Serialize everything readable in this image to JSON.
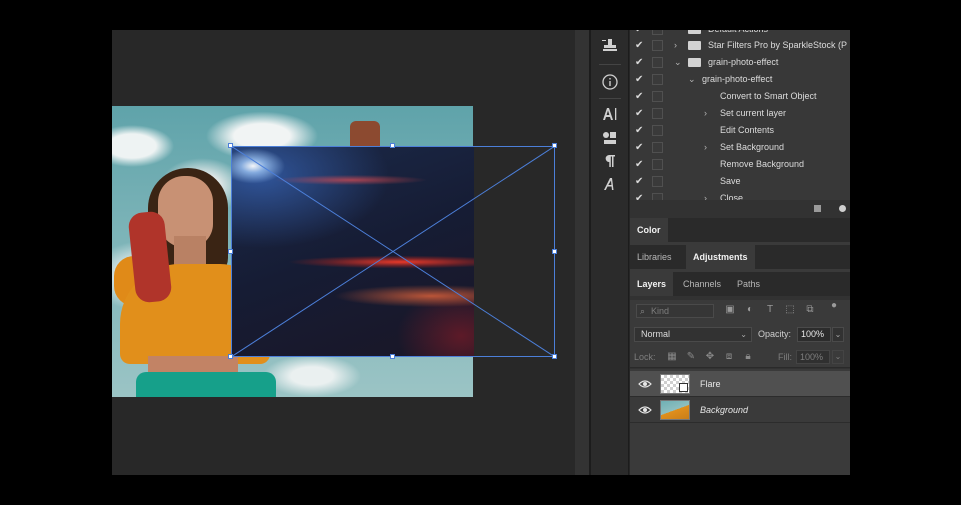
{
  "actions": {
    "items": [
      {
        "label": "Default Actions",
        "level": 0,
        "chevron": "",
        "folder": true
      },
      {
        "label": "Star Filters Pro by SparkleStock (P",
        "level": 0,
        "chevron": "›",
        "folder": true
      },
      {
        "label": "grain-photo-effect",
        "level": 0,
        "chevron": "⌄",
        "folder": true
      },
      {
        "label": "grain-photo-effect",
        "level": 1,
        "chevron": "⌄",
        "folder": false
      },
      {
        "label": "Convert to Smart Object",
        "level": 2,
        "chevron": "",
        "folder": false
      },
      {
        "label": "Set current layer",
        "level": 2,
        "chevron": "›",
        "folder": false
      },
      {
        "label": "Edit Contents",
        "level": 2,
        "chevron": "",
        "folder": false
      },
      {
        "label": "Set Background",
        "level": 2,
        "chevron": "›",
        "folder": false
      },
      {
        "label": "Remove Background",
        "level": 2,
        "chevron": "",
        "folder": false
      },
      {
        "label": "Save",
        "level": 2,
        "chevron": "",
        "folder": false
      },
      {
        "label": "Close",
        "level": 2,
        "chevron": "›",
        "folder": false
      }
    ],
    "check_glyph": "✔"
  },
  "panels": {
    "color_tab": "Color",
    "libraries_tab": "Libraries",
    "adjustments_tab": "Adjustments",
    "layers_tab": "Layers",
    "channels_tab": "Channels",
    "paths_tab": "Paths"
  },
  "layers": {
    "kind_placeholder": "Kind",
    "blend_mode": "Normal",
    "opacity_label": "Opacity:",
    "opacity_value": "100%",
    "lock_label": "Lock:",
    "fill_label": "Fill:",
    "fill_value": "100%",
    "items": [
      {
        "name": "Flare",
        "selected": true,
        "italic": false
      },
      {
        "name": "Background",
        "selected": false,
        "italic": true
      }
    ]
  },
  "icons": {
    "tools": [
      "stamp-icon",
      "info-icon",
      "character-icon",
      "swatches-icon",
      "paragraph-icon",
      "glyphs-icon"
    ],
    "eye": "eye-icon"
  },
  "colors": {
    "transform_accent": "#4c7fd9",
    "panel_bg": "#3a3a3a",
    "selected_layer": "#505050"
  }
}
